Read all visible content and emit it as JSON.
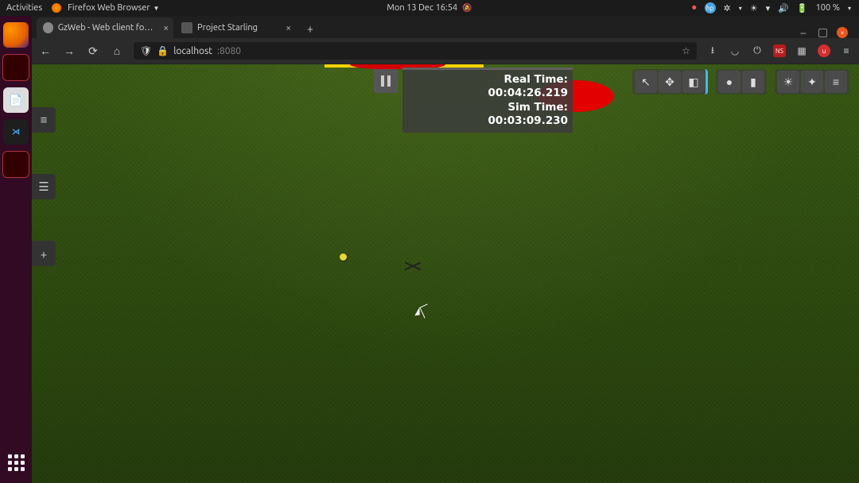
{
  "topbar": {
    "activities": "Activities",
    "app": "Firefox Web Browser",
    "datetime": "Mon 13 Dec   16:54",
    "battery": "100 %"
  },
  "browser": {
    "tabs": [
      {
        "title": "GzWeb - Web client for G…",
        "active": true
      },
      {
        "title": "Project Starling",
        "active": false
      }
    ],
    "url_host": "localhost",
    "url_port": ":8080"
  },
  "sim": {
    "real_time_label": "Real Time:",
    "real_time_value": "00:04:26.219",
    "sim_time_label": "Sim Time:",
    "sim_time_value": "00:03:09.230"
  },
  "manip": {
    "groups": [
      [
        "pointer",
        "move",
        "rotate"
      ],
      [
        "sphere",
        "box"
      ],
      [
        "sun",
        "spot",
        "parallel"
      ]
    ]
  },
  "side": {
    "menu": "≡",
    "tree": "☰",
    "add": "+"
  }
}
